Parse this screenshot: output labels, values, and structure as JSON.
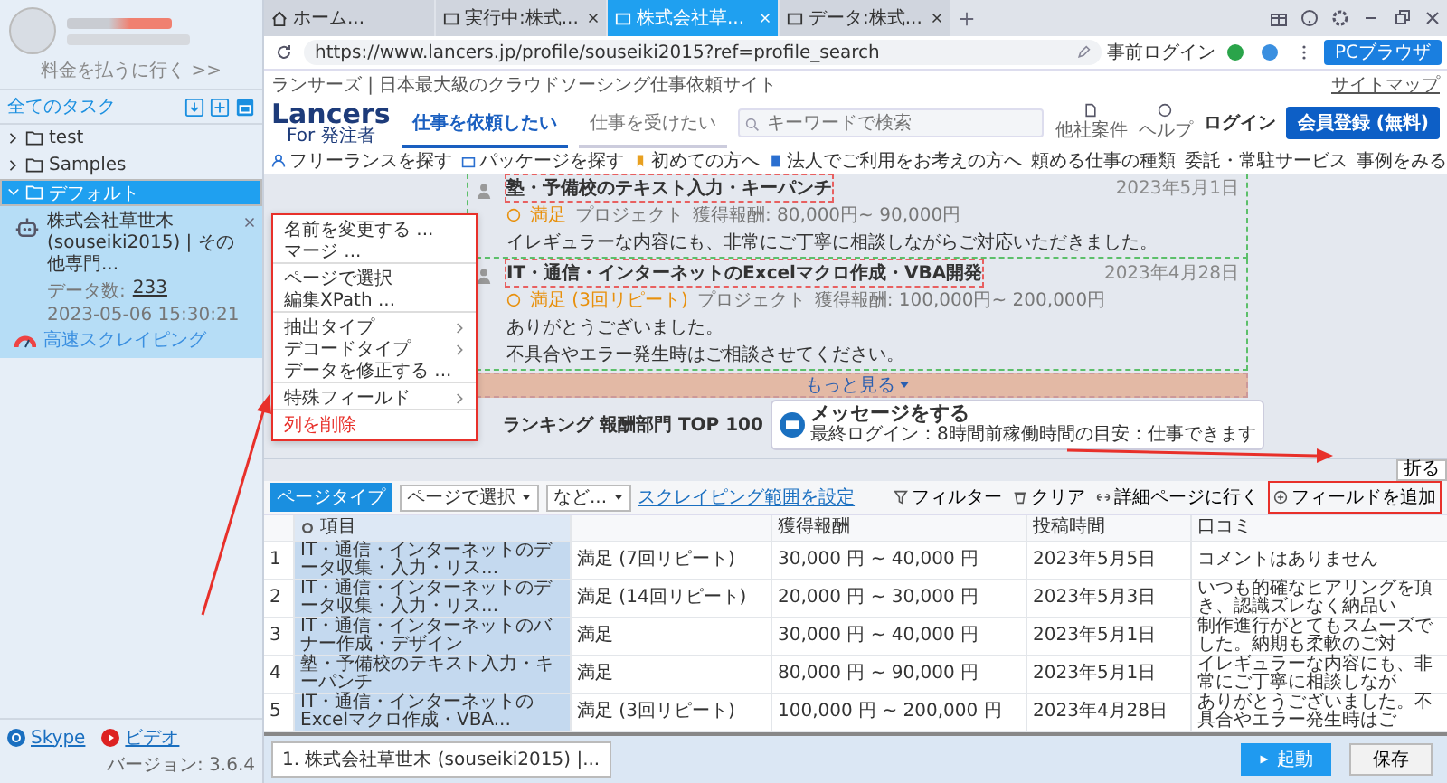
{
  "sidebar": {
    "pay_link": "料金を払うに行く >>",
    "all_tasks": "全てのタスク",
    "folders": [
      {
        "label": "test",
        "expanded": false,
        "selected": false
      },
      {
        "label": "Samples",
        "expanded": false,
        "selected": false
      },
      {
        "label": "デフォルト",
        "expanded": true,
        "selected": true,
        "tasks": [
          {
            "title": "株式会社草世木 (souseiki2015) | その他専門...",
            "count_label": "データ数:",
            "count": "233",
            "timestamp": "2023-05-06 15:30:21",
            "mode": "高速スクレイピング"
          }
        ]
      }
    ],
    "skype": "Skype",
    "video": "ビデオ",
    "version": "バージョン: 3.6.4"
  },
  "browser": {
    "tabs": [
      {
        "label": "ホーム...",
        "closable": false,
        "selected": false
      },
      {
        "label": "実行中:株式...",
        "closable": true,
        "selected": false
      },
      {
        "label": "株式会社草...",
        "closable": true,
        "selected": true
      },
      {
        "label": "データ:株式...",
        "closable": true,
        "selected": false
      }
    ],
    "url": "https://www.lancers.jp/profile/souseiki2015?ref=profile_search",
    "pre_login": "事前ログイン",
    "mode_button": "PCブラウザ"
  },
  "webpage": {
    "tagline": "ランサーズ | 日本最大級のクラウドソーシング仕事依頼サイト",
    "sitemap": "サイトマップ",
    "logo": "Lancers",
    "logo_sub": "For 発注者",
    "tabs": [
      {
        "label": "仕事を依頼したい",
        "selected": true
      },
      {
        "label": "仕事を受けたい",
        "selected": false
      }
    ],
    "search_placeholder": "キーワードで検索",
    "other_jobs": "他社案件",
    "help": "ヘルプ",
    "login": "ログイン",
    "signup": "会員登録 (無料)",
    "nav": [
      "フリーランスを探す",
      "パッケージを探す",
      "初めての方へ",
      "法人でご利用をお考えの方へ",
      "頼める仕事の種類",
      "委託・常駐サービス",
      "事例をみる"
    ],
    "reviews": [
      {
        "title": "塾・予備校のテキスト入力・キーパンチ",
        "date": "2023年5月1日",
        "rating": "満足",
        "type": "プロジェクト",
        "reward": "獲得報酬: 80,000円~ 90,000円",
        "body": [
          "イレギュラーな内容にも、非常にご丁寧に相談しながらご対応いただきました。"
        ]
      },
      {
        "title": "IT・通信・インターネットのExcelマクロ作成・VBA開発",
        "date": "2023年4月28日",
        "rating": "満足 (3回リピート)",
        "type": "プロジェクト",
        "reward": "獲得報酬: 100,000円~ 200,000円",
        "body": [
          "ありがとうございました。",
          "不具合やエラー発生時はご相談させてください。"
        ]
      }
    ],
    "more": "もっと見る",
    "ranking": "ランキング 報酬部門 TOP 100",
    "message_title": "メッセージをする",
    "message_sub": "最終ログイン：8時間前稼働時間の目安：仕事できます"
  },
  "context_menu": [
    {
      "label": "名前を変更する ...",
      "kind": "plain",
      "separator_after": false
    },
    {
      "label": "マージ ...",
      "kind": "plain",
      "separator_after": true
    },
    {
      "label": "ページで選択",
      "kind": "plain",
      "separator_after": false
    },
    {
      "label": "編集XPath ...",
      "kind": "plain",
      "separator_after": true
    },
    {
      "label": "抽出タイプ",
      "kind": "submenu",
      "separator_after": false
    },
    {
      "label": "デコードタイプ",
      "kind": "submenu",
      "separator_after": false
    },
    {
      "label": "データを修正する ...",
      "kind": "plain",
      "separator_after": true
    },
    {
      "label": "特殊フィールド",
      "kind": "submenu",
      "separator_after": true
    },
    {
      "label": "列を削除",
      "kind": "danger",
      "separator_after": false
    }
  ],
  "data_pane": {
    "collapse": "折る",
    "page_type": "ページタイプ",
    "page_select": "ページで選択",
    "second_select": "など...",
    "range_link": "スクレイピング範囲を設定",
    "filter": "フィルター",
    "clear": "クリア",
    "detail": "詳細ページに行く",
    "add_field": "フィールドを追加",
    "columns": {
      "item": "項目",
      "reward": "獲得報酬",
      "posted": "投稿時間",
      "review": "口コミ"
    },
    "rows": [
      {
        "index": "1",
        "item": "IT・通信・インターネットのデータ収集・入力・リス...",
        "column_2": "満足 (7回リピート)",
        "reward": "30,000 円 ~ 40,000 円",
        "posted": "2023年5月5日",
        "review": "コメントはありません"
      },
      {
        "index": "2",
        "item": "IT・通信・インターネットのデータ収集・入力・リス...",
        "column_2": "満足 (14回リピート)",
        "reward": "20,000 円 ~ 30,000 円",
        "posted": "2023年5月3日",
        "review": "いつも的確なヒアリングを頂き、認識ズレなく納品い"
      },
      {
        "index": "3",
        "item": "IT・通信・インターネットのバナー作成・デザイン",
        "column_2": "満足",
        "reward": "30,000 円 ~ 40,000 円",
        "posted": "2023年5月1日",
        "review": "制作進行がとてもスムーズでした。納期も柔軟のご対"
      },
      {
        "index": "4",
        "item": "塾・予備校のテキスト入力・キーパンチ",
        "column_2": "満足",
        "reward": "80,000 円 ~ 90,000 円",
        "posted": "2023年5月1日",
        "review": "イレギュラーな内容にも、非常にご丁寧に相談しなが"
      },
      {
        "index": "5",
        "item": "IT・通信・インターネットのExcelマクロ作成・VBA...",
        "column_2": "満足 (3回リピート)",
        "reward": "100,000 円 ~ 200,000 円",
        "posted": "2023年4月28日",
        "review": "ありがとうございました。不具合やエラー発生時はご"
      }
    ]
  },
  "task_tabs": [
    "1. 株式会社草世木 (souseiki2015) |..."
  ],
  "run_button": "起動",
  "save_button": "保存"
}
